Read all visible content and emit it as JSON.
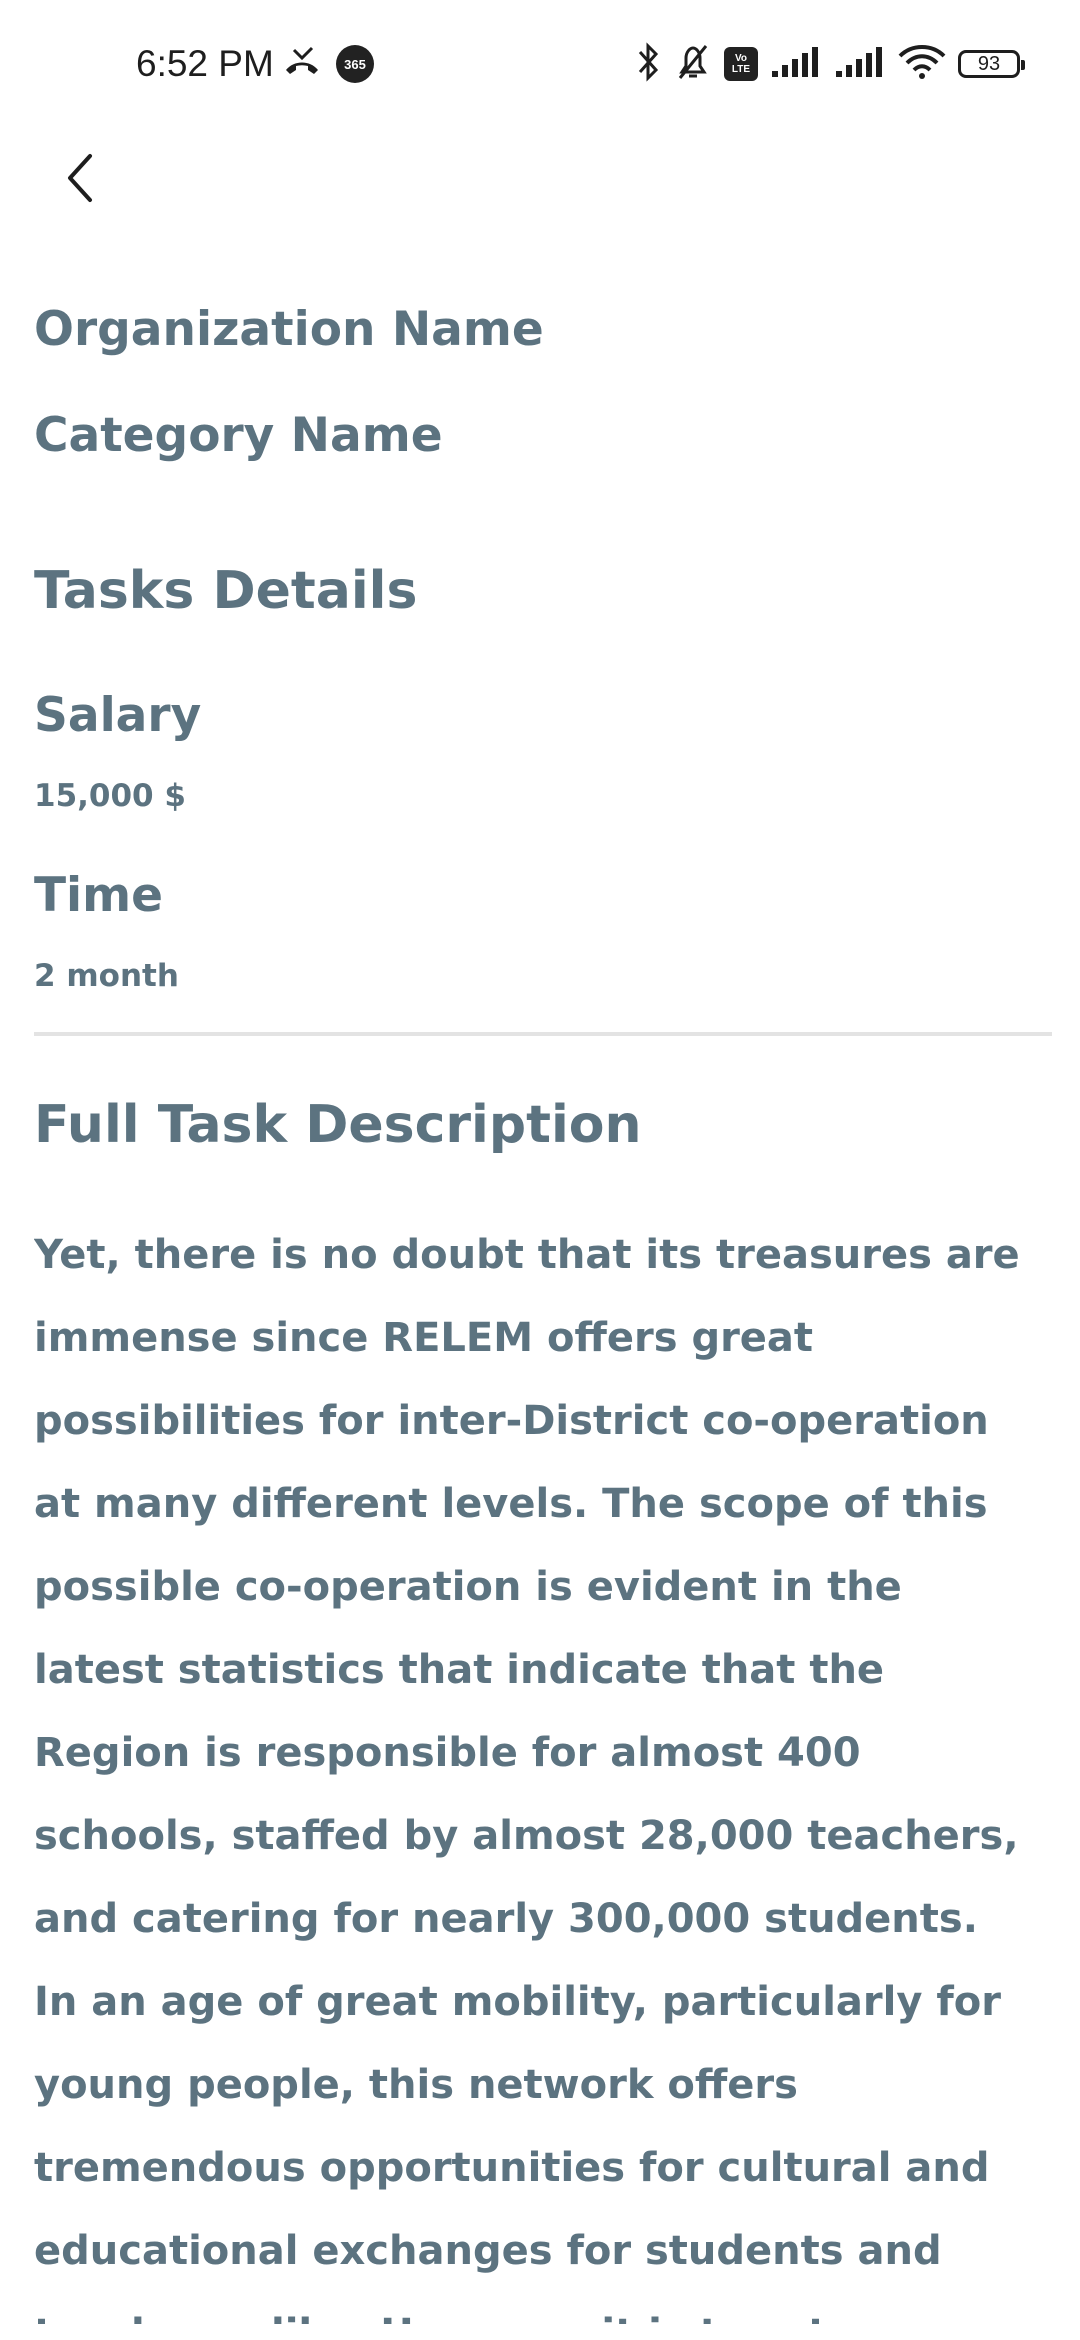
{
  "status_bar": {
    "time": "6:52 PM",
    "badge": "365",
    "volte_top": "Vo",
    "volte_bottom": "LTE",
    "battery": "93"
  },
  "header": {
    "back_icon": "chevron-left-icon"
  },
  "organization_name": "Organization Name",
  "category_name": "Category Name",
  "tasks_details": {
    "title": "Tasks Details",
    "salary_label": "Salary",
    "salary_value": "15,000 $",
    "time_label": "Time",
    "time_value": "2 month"
  },
  "description": {
    "title": "Full Task Description",
    "body": "Yet, there is no doubt that its treasures are immense since RELEM offers great possibilities for inter-District co-operation at many different levels. The scope of this possible co-operation is evident in the latest statistics that indicate that the Region is responsible for almost 400 schools, staffed by almost 28,000 teachers, and catering for nearly 300,000 students.  In an age of great mobility, particularly for young people, this network offers tremendous opportunities for cultural and educational exchanges for students and teachers alike. However, it is true to say that we have yet to unlock much of this potential. The website aims, among others"
  },
  "colors": {
    "text": "#5c7380",
    "divider": "#e3e3e3",
    "background": "#ffffff"
  }
}
